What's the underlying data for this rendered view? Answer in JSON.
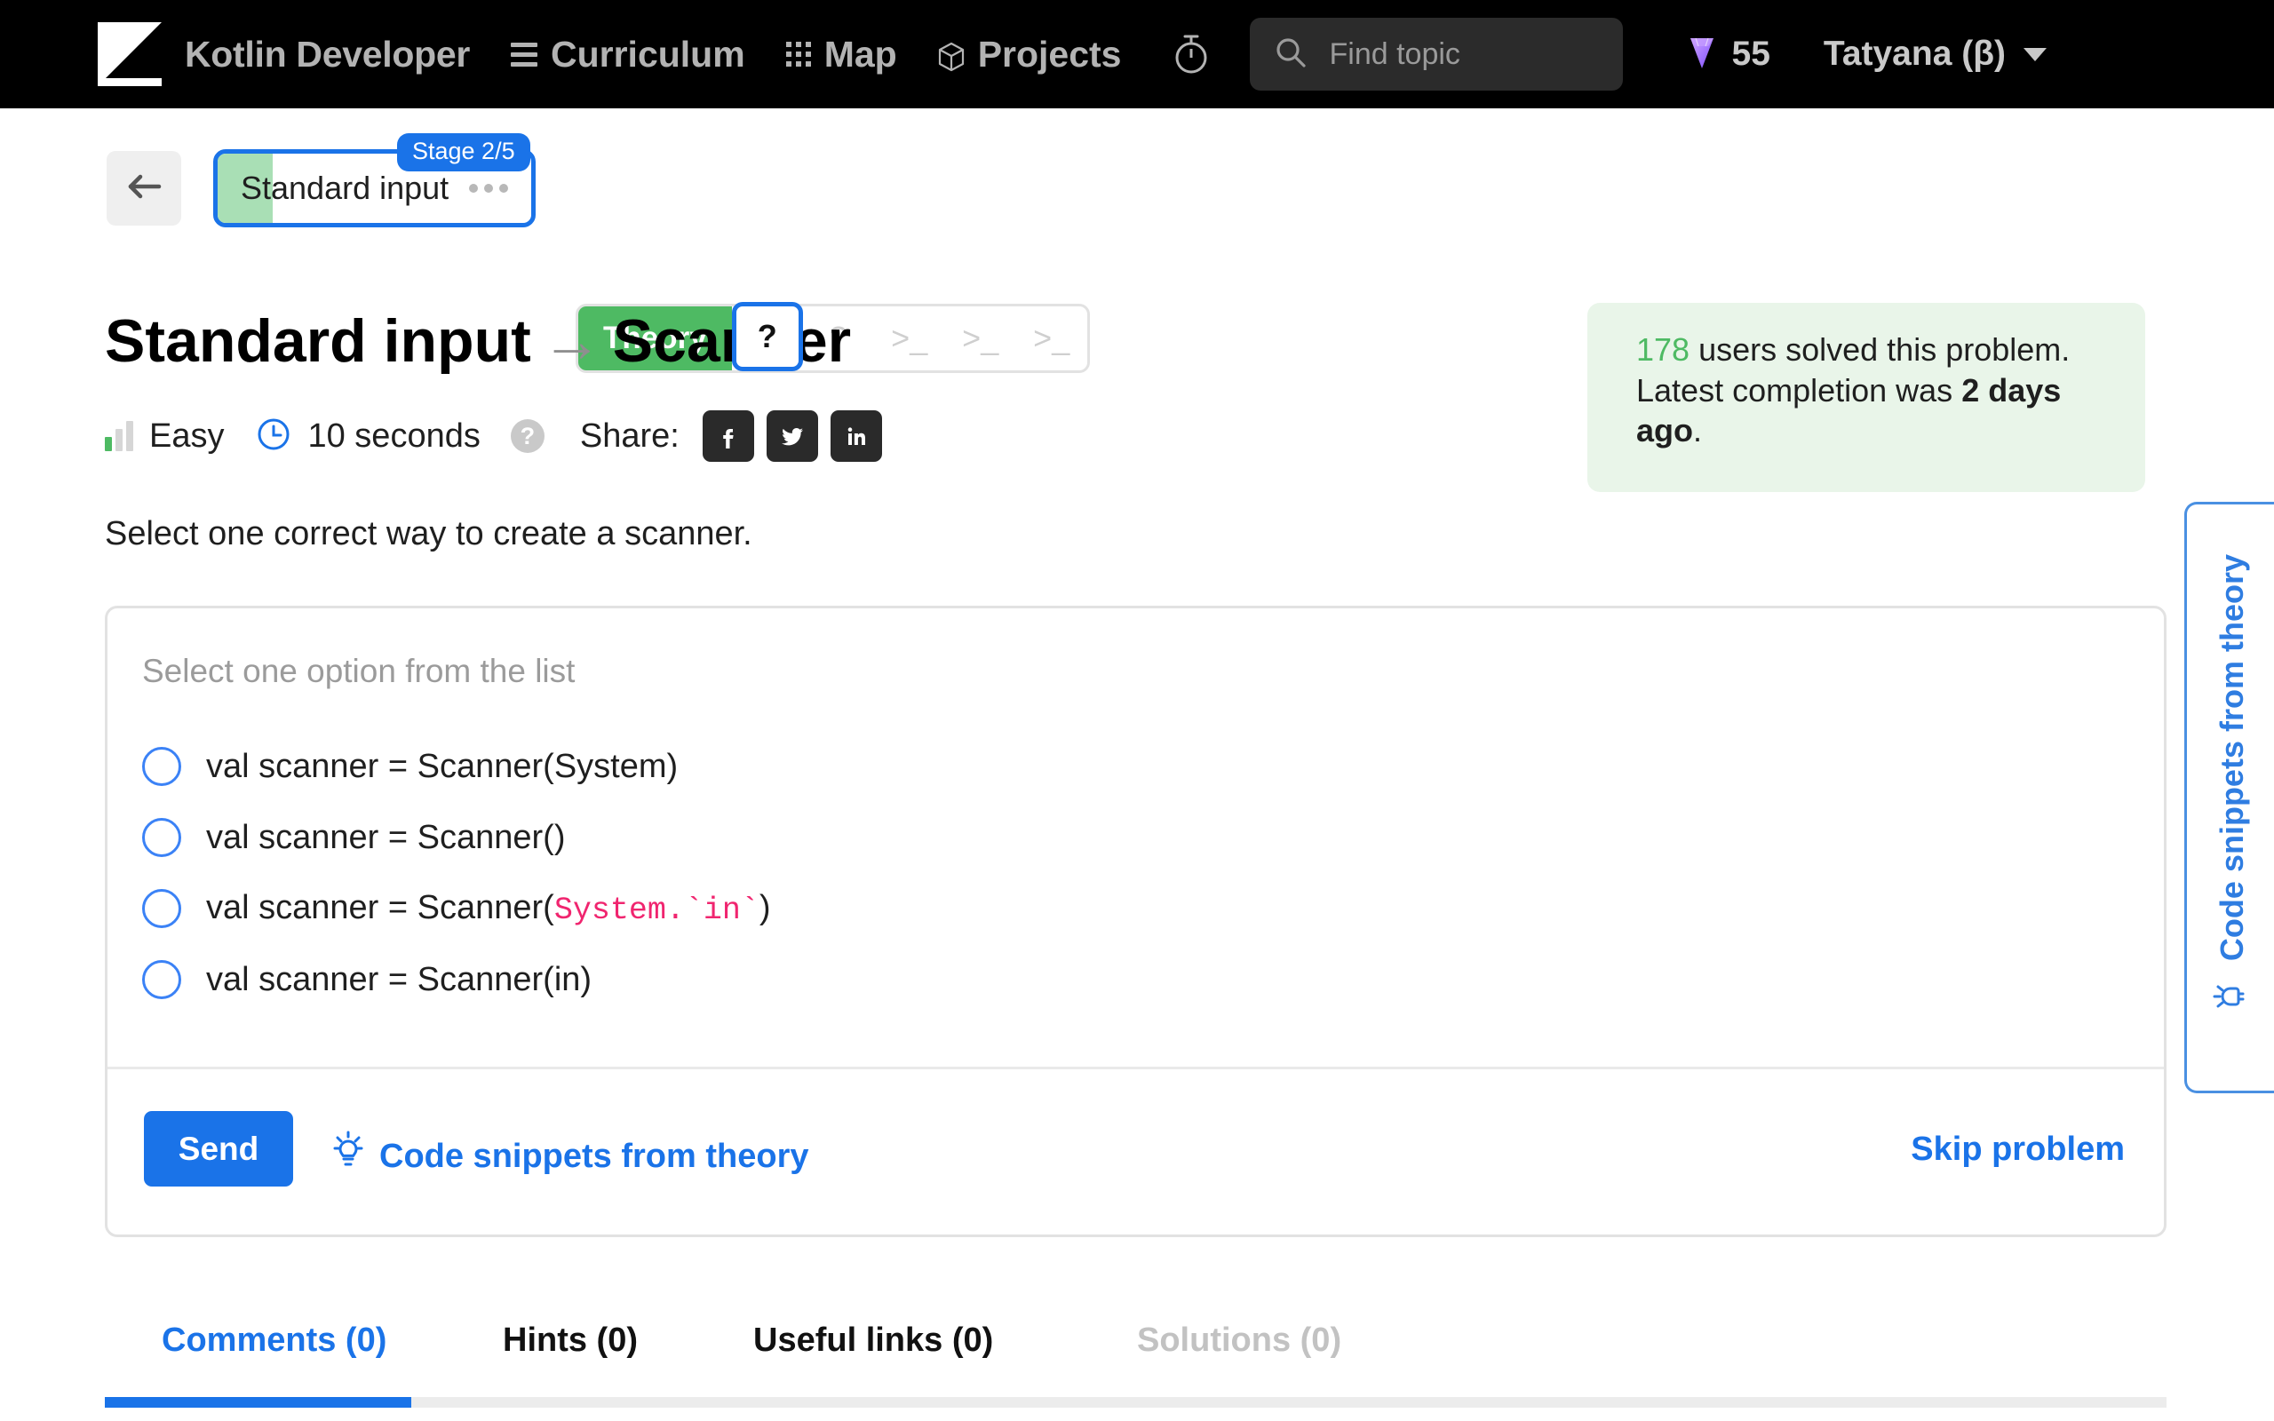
{
  "header": {
    "brand": "Kotlin Developer",
    "logo_icon": "hyperskill-logo-icon",
    "nav": [
      {
        "label": "Curriculum",
        "icon": "hamburger-icon"
      },
      {
        "label": "Map",
        "icon": "grid-icon"
      },
      {
        "label": "Projects",
        "icon": "cube-icon"
      }
    ],
    "timer_icon": "stopwatch-icon",
    "search": {
      "placeholder": "Find topic",
      "icon": "search-icon",
      "value": ""
    },
    "gems": {
      "count": "55",
      "icon": "gem-icon"
    },
    "user": {
      "name": "Tatyana (β)",
      "caret_icon": "chevron-down-icon"
    }
  },
  "stagebar": {
    "back_icon": "arrow-left-icon",
    "topic_chip": {
      "label": "Standard input",
      "more_icon": "ellipsis-icon"
    },
    "stage_badge": "Stage 2/5",
    "steps": [
      {
        "label": "Theory",
        "type": "theory",
        "state": "done"
      },
      {
        "label": "?",
        "type": "quiz",
        "state": "active"
      },
      {
        "label": "?",
        "type": "quiz",
        "state": "locked"
      },
      {
        "label": ">_",
        "type": "code",
        "state": "locked"
      },
      {
        "label": ">_",
        "type": "code",
        "state": "locked"
      },
      {
        "label": ">_",
        "type": "code",
        "state": "locked"
      }
    ]
  },
  "main": {
    "title_first": "Standard input",
    "title_arrow": "→",
    "title_second": "Scanner",
    "difficulty": "Easy",
    "difficulty_icon": "signal-bars-icon",
    "duration": "10 seconds",
    "clock_icon": "clock-icon",
    "help_icon": "question-circle-icon",
    "share_label": "Share:",
    "share_buttons": [
      {
        "name": "facebook-icon"
      },
      {
        "name": "twitter-icon"
      },
      {
        "name": "linkedin-icon"
      }
    ],
    "question": "Select one correct way to create a scanner."
  },
  "info_box": {
    "count": "178",
    "text_mid": " users solved this problem. Latest completion was ",
    "time": "2 days ago",
    "text_end": "."
  },
  "quiz": {
    "hint": "Select one option from the list",
    "options": [
      {
        "plain": "val scanner = Scanner(System)",
        "pre": "val scanner = Scanner(System)",
        "code": "",
        "post": ""
      },
      {
        "plain": "val scanner = Scanner()",
        "pre": "val scanner = Scanner()",
        "code": "",
        "post": ""
      },
      {
        "plain": "val scanner = Scanner(System.`in`)",
        "pre": "val scanner = Scanner(",
        "code": "System.`in`",
        "post": ")"
      },
      {
        "plain": "val scanner = Scanner(in)",
        "pre": "val scanner = Scanner(in)",
        "code": "",
        "post": ""
      }
    ],
    "send_label": "Send",
    "snippets_label": "Code snippets from theory",
    "snippets_icon": "lightbulb-icon",
    "skip_label": "Skip problem"
  },
  "side_panel": {
    "label": "Code snippets from theory",
    "icon": "lightbulb-icon"
  },
  "bottom_tabs": [
    {
      "label": "Comments (0)",
      "state": "active"
    },
    {
      "label": "Hints (0)",
      "state": "normal"
    },
    {
      "label": "Useful links (0)",
      "state": "normal"
    },
    {
      "label": "Solutions (0)",
      "state": "muted"
    }
  ],
  "colors": {
    "accent_blue": "#1a73e8",
    "green": "#4eba63",
    "pink_code": "#f0256f",
    "header_bg": "#000000",
    "info_bg": "#e9f5e9"
  }
}
